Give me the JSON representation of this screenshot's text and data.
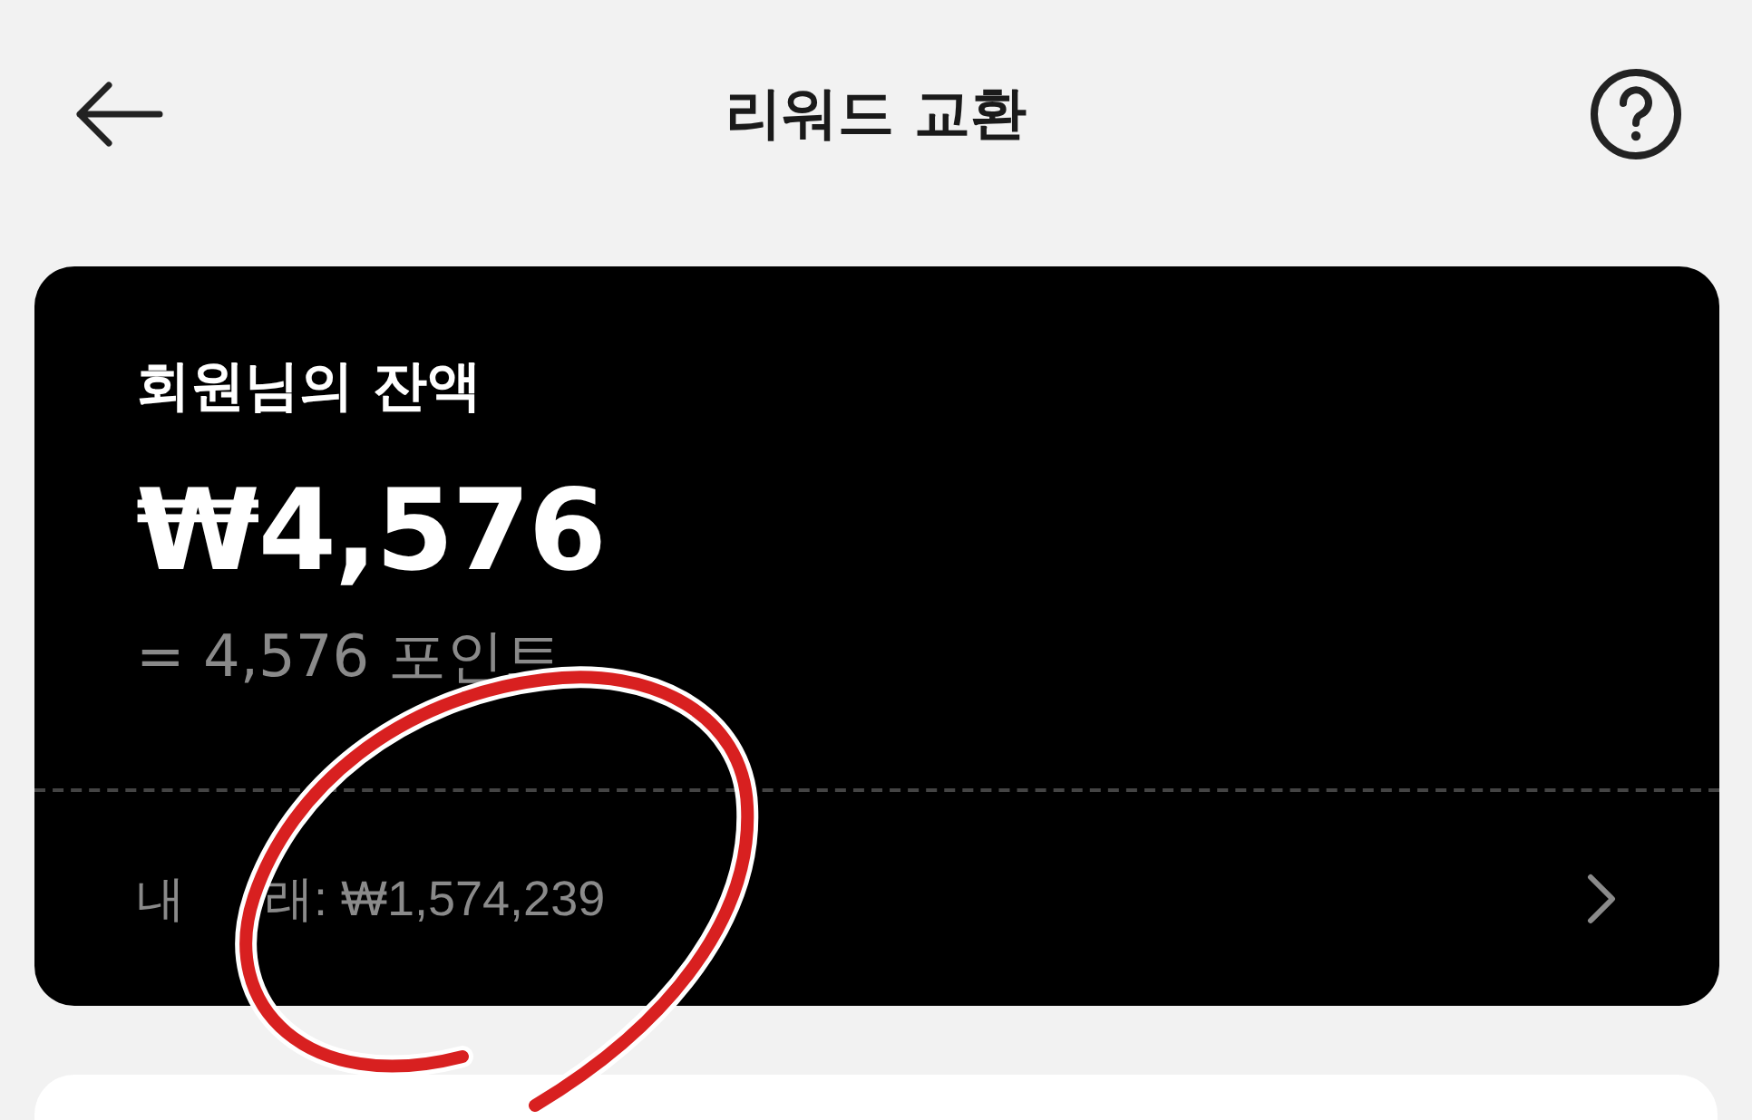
{
  "header": {
    "title": "리워드 교환"
  },
  "balance_card": {
    "label": "회원님의 잔액",
    "amount": "₩4,576",
    "points": "= 4,576 포인트",
    "transactions": [
      "내",
      "래: ₩1,574,239"
    ]
  }
}
